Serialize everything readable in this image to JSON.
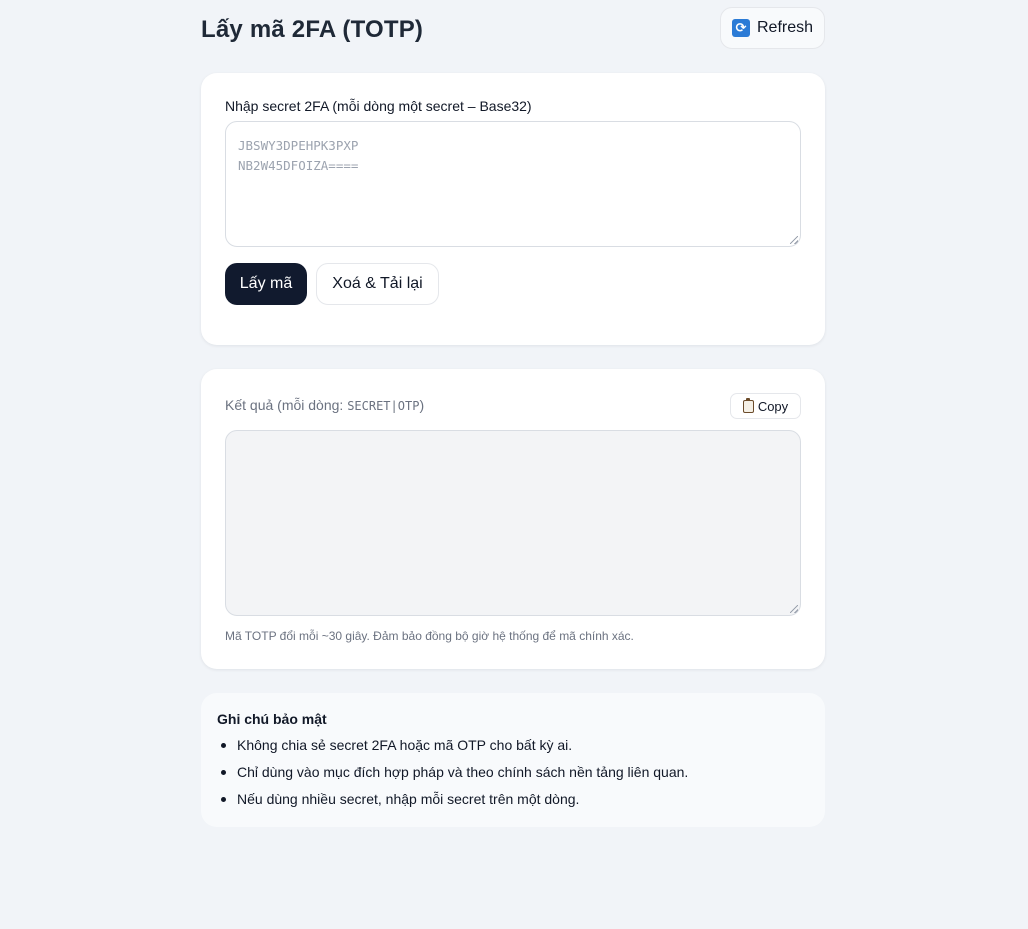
{
  "header": {
    "title": "Lấy mã 2FA (TOTP)",
    "refresh_label": "Refresh",
    "refresh_icon": "refresh-icon"
  },
  "input_card": {
    "label": "Nhập secret 2FA (mỗi dòng một secret – Base32)",
    "placeholder_lines": [
      "JBSWY3DPEHPK3PXP",
      "NB2W45DFOIZA===="
    ],
    "primary_button": "Lấy mã",
    "secondary_button": "Xoá & Tải lại"
  },
  "output_card": {
    "label_prefix": "Kết quả (mỗi dòng: ",
    "label_format": "SECRET|OTP",
    "label_suffix": ")",
    "copy_label": "Copy",
    "copy_icon": "clipboard-icon",
    "value": "",
    "hint": "Mã TOTP đổi mỗi ~30 giây. Đảm bảo đồng bộ giờ hệ thống để mã chính xác."
  },
  "security_note": {
    "title": "Ghi chú bảo mật",
    "items": [
      "Không chia sẻ secret 2FA hoặc mã OTP cho bất kỳ ai.",
      "Chỉ dùng vào mục đích hợp pháp và theo chính sách nền tảng liên quan.",
      "Nếu dùng nhiều secret, nhập mỗi secret trên một dòng."
    ]
  },
  "colors": {
    "background": "#f1f4f8",
    "primary_button": "#111a2e",
    "card": "#ffffff"
  }
}
